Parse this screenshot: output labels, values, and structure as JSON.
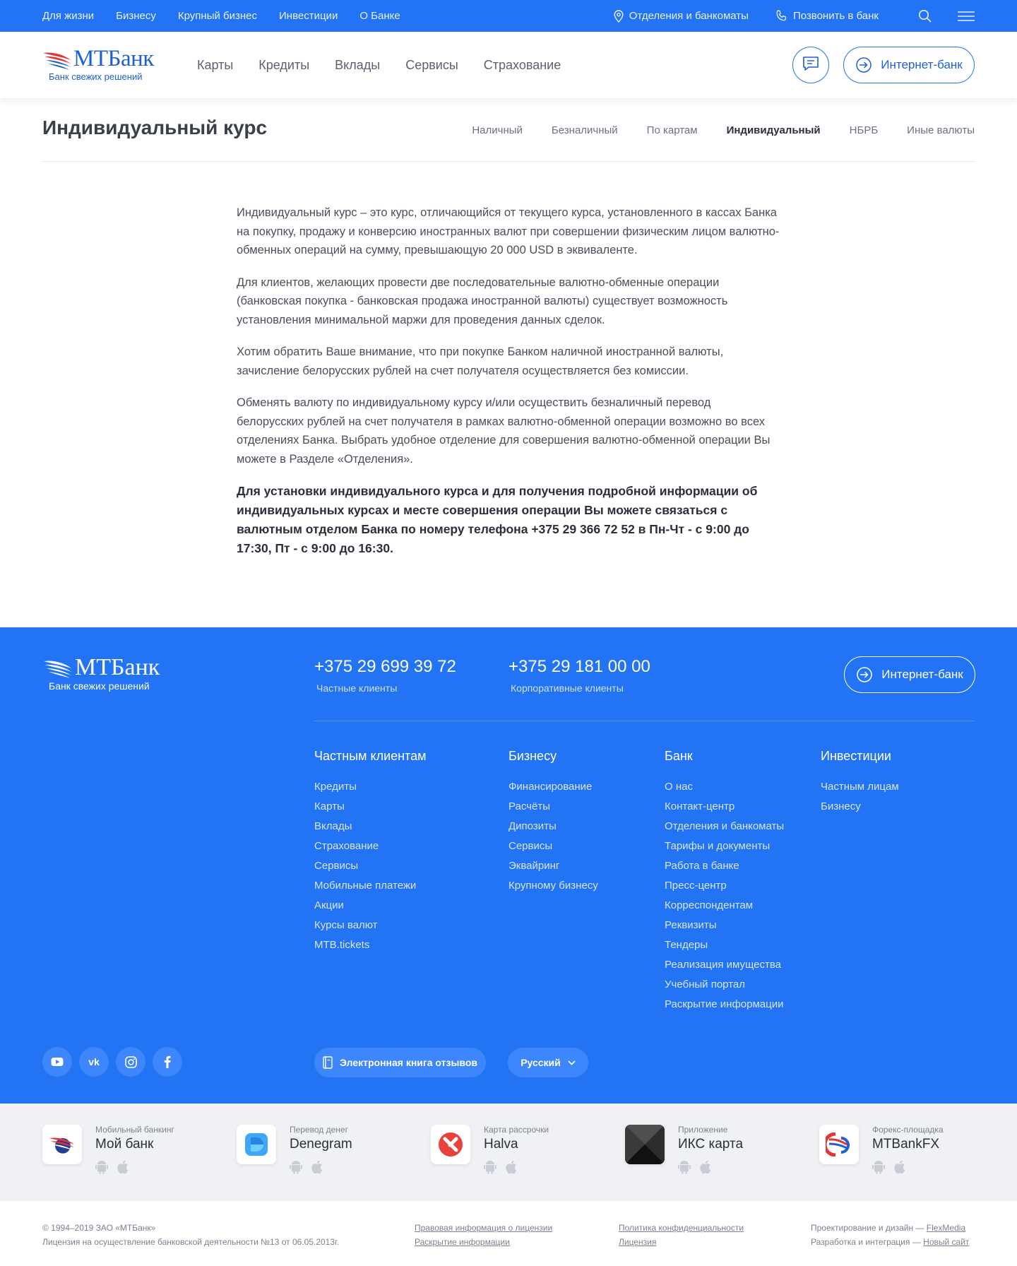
{
  "topbar": {
    "links": [
      "Для жизни",
      "Бизнесу",
      "Крупный бизнес",
      "Инвестиции",
      "О Банке"
    ],
    "branches": "Отделения и банкоматы",
    "call": "Позвонить в банк"
  },
  "brand": {
    "name": "МТБанк",
    "tagline": "Банк свежих решений"
  },
  "header": {
    "nav": [
      "Карты",
      "Кредиты",
      "Вклады",
      "Сервисы",
      "Страхование"
    ],
    "internet_bank": "Интернет-банк"
  },
  "page": {
    "title": "Индивидуальный курс",
    "subnav": [
      "Наличный",
      "Безналичный",
      "По картам",
      "Индивидуальный",
      "НБРБ",
      "Иные валюты"
    ],
    "active_subnav": "Индивидуальный"
  },
  "article": {
    "p1": "Индивидуальный курс – это курс, отличающийся от текущего курса, установленного в кассах Банка на покупку, продажу и конверсию иностранных валют при совершении физическим лицом валютно-обменных операций на сумму, превышающую 20 000 USD в эквиваленте.",
    "p2": "Для клиентов, желающих провести две последовательные валютно-обменные операции (банковская покупка - банковская продажа иностранной валюты) существует возможность установления минимальной маржи для проведения данных сделок.",
    "p3": "Хотим обратить Ваше внимание, что при покупке Банком наличной иностранной валюты, зачисление белорусских рублей на счет получателя осуществляется без комиссии.",
    "p4": "Обменять валюту по индивидуальному курсу и/или осуществить безналичный перевод белорусских рублей на счет получателя в рамках валютно-обменной операции возможно во всех отделениях Банка. Выбрать удобное отделение для совершения валютно-обменной операции Вы можете в Разделе «Отделения».",
    "p5": "Для установки индивидуального курса и для получения подробной информации об индивидуальных курсах и месте совершения операции Вы можете связаться с валютным отделом Банка по номеру телефона +375 29 366 72 52 в Пн-Чт - с 9:00 до 17:30, Пт - с 9:00 до 16:30."
  },
  "footer": {
    "phones": [
      {
        "number": "+375 29 699 39 72",
        "caption": "Частные клиенты"
      },
      {
        "number": "+375 29 181 00 00",
        "caption": "Корпоративные клиенты"
      }
    ],
    "internet_bank": "Интернет-банк",
    "columns": [
      {
        "title": "Частным клиентам",
        "items": [
          "Кредиты",
          "Карты",
          "Вклады",
          "Страхование",
          "Сервисы",
          "Мобильные платежи",
          "Акции",
          "Курсы валют",
          "MTB.tickets"
        ]
      },
      {
        "title": "Бизнесу",
        "items": [
          "Финансирование",
          "Расчёты",
          "Дипозиты",
          "Сервисы",
          "Эквайринг",
          "Крупному бизнесу"
        ]
      },
      {
        "title": "Банк",
        "items": [
          "О нас",
          "Контакт-центр",
          "Отделения и банкоматы",
          "Тарифы и документы",
          "Работа в банке",
          "Пресс-центр",
          "Корреспондентам",
          "Реквизиты",
          "Тендеры",
          "Реализация имущества",
          "Учебный портал",
          "Раскрытие информации"
        ]
      },
      {
        "title": "Инвестиции",
        "items": [
          "Частным лицам",
          "Бизнесу"
        ]
      }
    ],
    "social": [
      "youtube-icon",
      "vk-icon",
      "instagram-icon",
      "facebook-icon"
    ],
    "review_book": "Электронная книга отзывов",
    "language": "Русский"
  },
  "apps": [
    {
      "label": "Мобильный банкинг",
      "name": "Мой банк",
      "icon": "moy-bank-logo"
    },
    {
      "label": "Перевод денег",
      "name": "Denegram",
      "icon": "denegram-logo"
    },
    {
      "label": "Карта рассрочки",
      "name": "Halva",
      "icon": "halva-logo"
    },
    {
      "label": "Приложение",
      "name": "ИКС карта",
      "icon": "iks-card-logo"
    },
    {
      "label": "Форекс-площадка",
      "name": "MTBankFX",
      "icon": "mtbankfx-logo"
    }
  ],
  "legal": {
    "copyright": "© 1994–2019 ЗАО «МТБанк»",
    "license": "Лицензия на осуществление банковской деятельности №13 от 06.05.2013г.",
    "link1": "Правовая информация о лицензии",
    "link2": "Раскрытие информации",
    "link3": "Политика конфиденциальности",
    "link4": "Лицензия",
    "design_label": "Проектирование и дизайн — ",
    "design_link": "FlexMedia",
    "dev_label": "Разработка и интеграция — ",
    "dev_link": "Новый сайт"
  },
  "colors": {
    "primary": "#2373f5",
    "brand_text": "#1f5fd6",
    "footer_bg": "#2373f5",
    "apps_bg": "#f0f1f4"
  }
}
